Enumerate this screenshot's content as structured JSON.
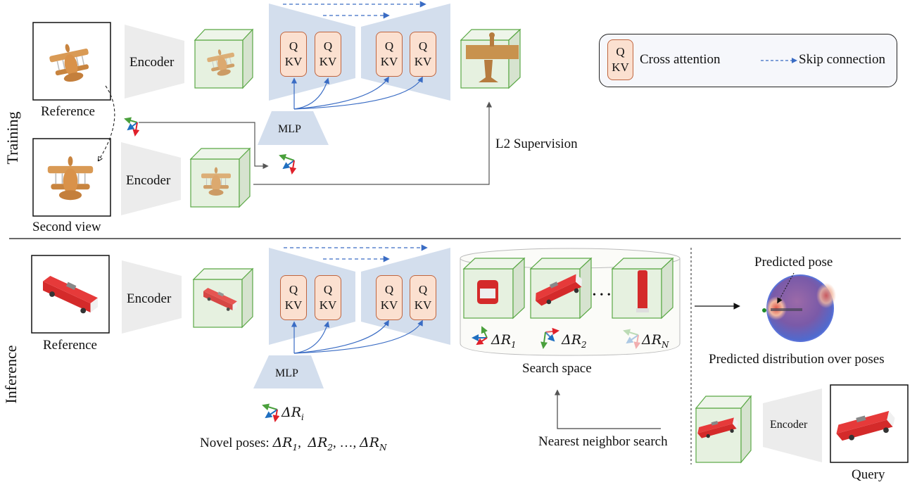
{
  "sections": {
    "training_label": "Training",
    "inference_label": "Inference"
  },
  "training": {
    "reference_caption": "Reference",
    "second_view_caption": "Second view",
    "encoder_top": "Encoder",
    "encoder_bottom": "Encoder",
    "mlp": "MLP",
    "qkv_blocks": [
      {
        "q": "Q",
        "kv": "KV"
      },
      {
        "q": "Q",
        "kv": "KV"
      },
      {
        "q": "Q",
        "kv": "KV"
      },
      {
        "q": "Q",
        "kv": "KV"
      }
    ],
    "supervision_label": "L2 Supervision"
  },
  "legend": {
    "qkv_q": "Q",
    "qkv_kv": "KV",
    "cross_attention": "Cross attention",
    "skip_connection": "Skip connection"
  },
  "inference": {
    "reference_caption": "Reference",
    "encoder": "Encoder",
    "mlp": "MLP",
    "qkv_blocks": [
      {
        "q": "Q",
        "kv": "KV"
      },
      {
        "q": "Q",
        "kv": "KV"
      },
      {
        "q": "Q",
        "kv": "KV"
      },
      {
        "q": "Q",
        "kv": "KV"
      }
    ],
    "delta_ri": "ΔR",
    "delta_ri_sub": "i",
    "novel_poses_prefix": "Novel poses: ",
    "novel_poses": [
      {
        "base": "ΔR",
        "sub": "1"
      },
      {
        "base": "ΔR",
        "sub": "2"
      },
      {
        "base": "ΔR",
        "sub": "N"
      }
    ],
    "ellipsis": "…",
    "search_space": {
      "label": "Search space",
      "items": [
        {
          "base": "ΔR",
          "sub": "1"
        },
        {
          "base": "ΔR",
          "sub": "2"
        },
        {
          "base": "ΔR",
          "sub": "N"
        }
      ],
      "dots": "• • •"
    },
    "nearest_neighbor": "Nearest neighbor search",
    "query_encoder": "Encoder",
    "query_caption": "Query",
    "predicted_pose": "Predicted pose",
    "predicted_distribution": "Predicted distribution over poses"
  },
  "colors": {
    "encoder_fill": "#ececec",
    "unet_fill": "#d3deed",
    "qkv_fill": "#fbe0d0",
    "qkv_border": "#c0653f",
    "cube_edge": "#5aa845",
    "cube_fill": "#e6f1e0",
    "arrow_blue": "#3a6cc4",
    "axis_green": "#4aa03c",
    "axis_blue": "#1f6fc0",
    "axis_red": "#e0202a",
    "legend_bg": "#f6f7fb"
  }
}
